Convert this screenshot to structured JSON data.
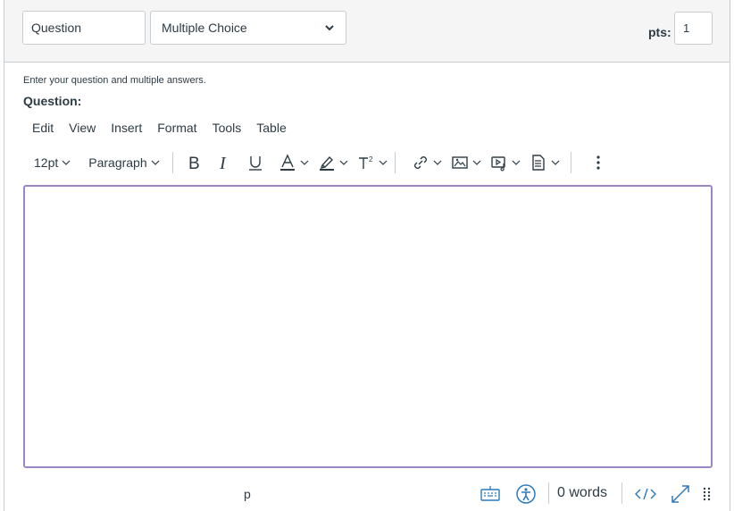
{
  "header": {
    "title_value": "Question",
    "type_select": {
      "selected": "Multiple Choice"
    },
    "points_label": "pts:",
    "points_value": "1"
  },
  "body": {
    "hint": "Enter your question and multiple answers.",
    "question_label": "Question:"
  },
  "menubar": {
    "items": [
      "Edit",
      "View",
      "Insert",
      "Format",
      "Tools",
      "Table"
    ]
  },
  "toolbar": {
    "font_size": "12pt",
    "block_format": "Paragraph"
  },
  "statusbar": {
    "path": "p",
    "word_count": "0 words"
  },
  "colors": {
    "accent": "#9c87c6",
    "border": "#c7cdd1",
    "text": "#2d3b45",
    "icon_blue": "#2b7abc",
    "header_bg": "#f5f5f5"
  }
}
